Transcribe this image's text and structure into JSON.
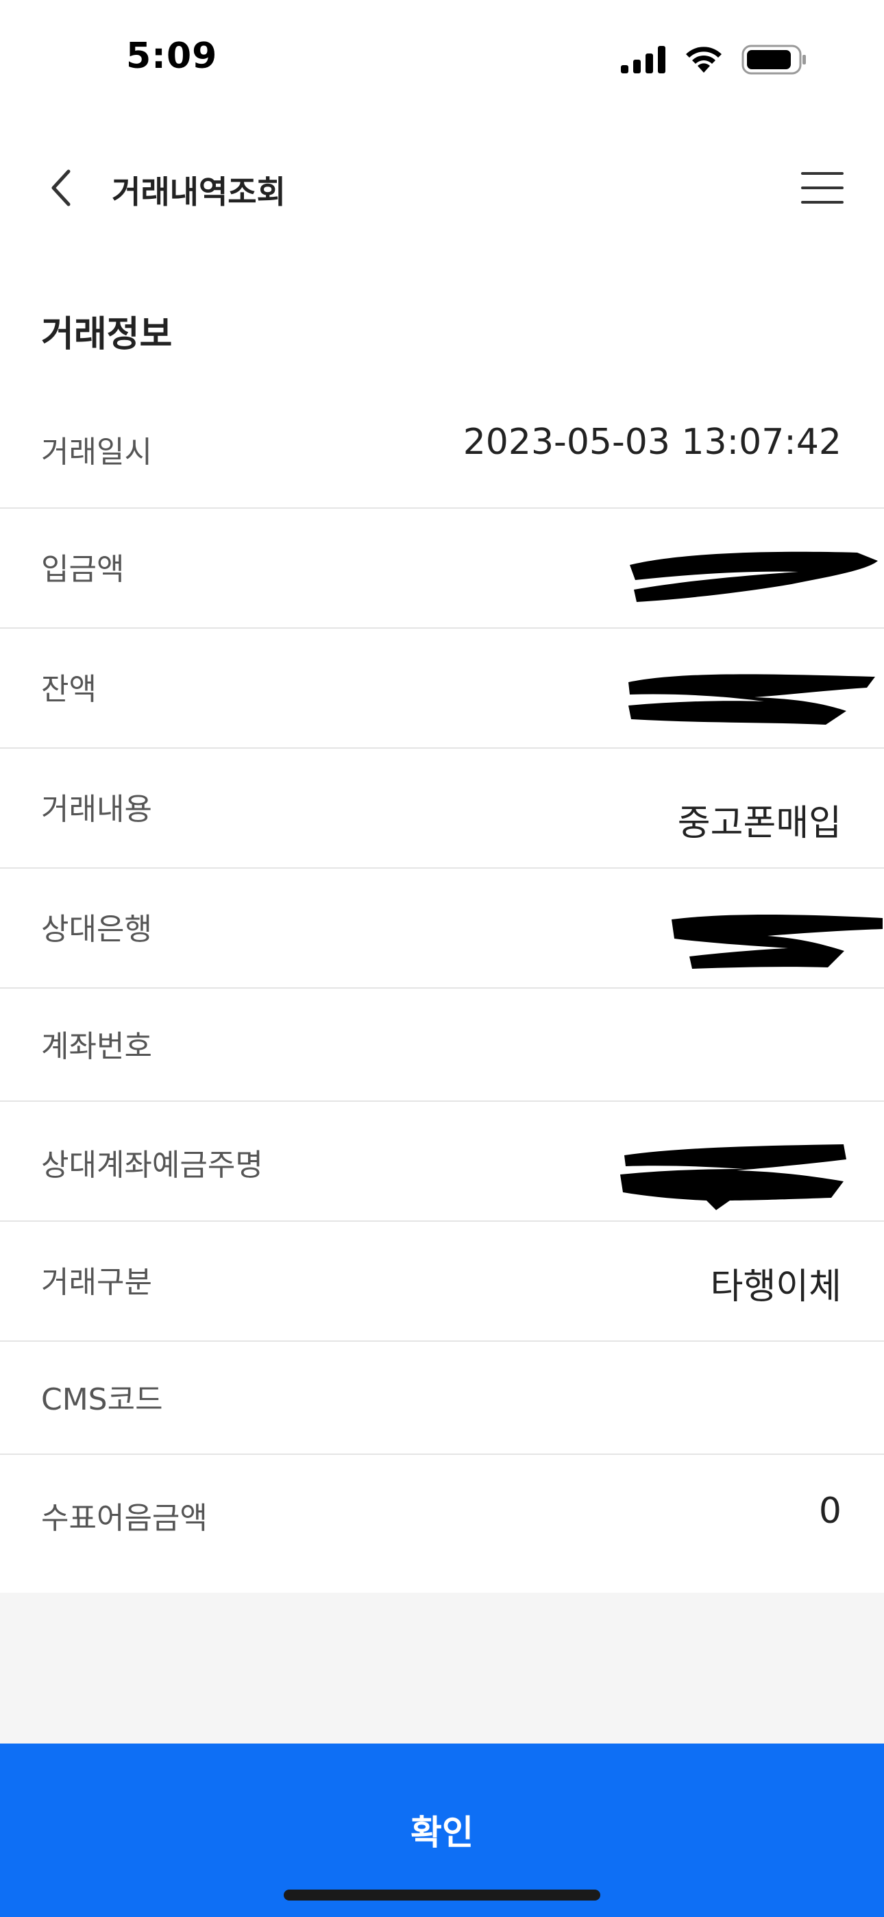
{
  "status_bar": {
    "time": "5:09"
  },
  "nav": {
    "title": "거래내역조회"
  },
  "section": {
    "title": "거래정보"
  },
  "rows": [
    {
      "label": "거래일시",
      "value": "2023-05-03 13:07:42"
    },
    {
      "label": "입금액",
      "value": ""
    },
    {
      "label": "잔액",
      "value": ""
    },
    {
      "label": "거래내용",
      "value": "중고폰매입"
    },
    {
      "label": "상대은행",
      "value": ""
    },
    {
      "label": "계좌번호",
      "value": ""
    },
    {
      "label": "상대계좌예금주명",
      "value": ""
    },
    {
      "label": "거래구분",
      "value": "타행이체"
    },
    {
      "label": "CMS코드",
      "value": ""
    },
    {
      "label": "수표어음금액",
      "value": "0"
    }
  ],
  "confirm": {
    "label": "확인"
  },
  "colors": {
    "accent": "#0e6ff5",
    "divider": "#e4e4e4",
    "grey_area": "#f5f5f5"
  }
}
